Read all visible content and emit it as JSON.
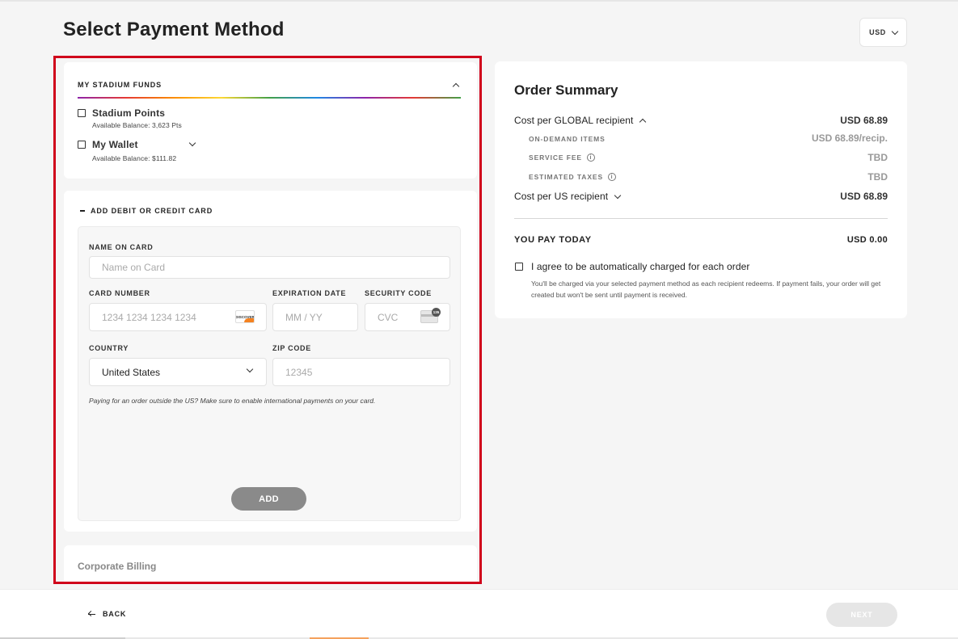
{
  "page": {
    "title": "Select Payment Method"
  },
  "currency": {
    "label": "USD"
  },
  "funds": {
    "header": "MY STADIUM FUNDS",
    "items": [
      {
        "name": "Stadium Points",
        "balance": "Available Balance: 3,623 Pts",
        "checked": false
      },
      {
        "name": "My Wallet",
        "balance": "Available Balance: $111.82",
        "checked": false
      }
    ]
  },
  "card_form": {
    "header": "ADD DEBIT OR CREDIT CARD",
    "name_label": "NAME ON CARD",
    "name_placeholder": "Name on Card",
    "number_label": "CARD NUMBER",
    "number_placeholder": "1234 1234 1234 1234",
    "card_brand": "DISCOVER",
    "expiry_label": "EXPIRATION DATE",
    "expiry_placeholder": "MM / YY",
    "cvc_label": "SECURITY CODE",
    "cvc_placeholder": "CVC",
    "cvc_icon_text": "135",
    "country_label": "COUNTRY",
    "country_value": "United States",
    "zip_label": "ZIP CODE",
    "zip_placeholder": "12345",
    "note": "Paying for an order outside the US? Make sure to enable international payments on your card.",
    "add_label": "ADD"
  },
  "corporate": {
    "label": "Corporate Billing"
  },
  "summary": {
    "title": "Order Summary",
    "global_label": "Cost per GLOBAL recipient",
    "global_value": "USD 68.89",
    "ondemand_label": "ON-DEMAND ITEMS",
    "ondemand_value": "USD 68.89/recip.",
    "service_label": "SERVICE FEE",
    "service_value": "TBD",
    "taxes_label": "ESTIMATED TAXES",
    "taxes_value": "TBD",
    "us_label": "Cost per US recipient",
    "us_value": "USD 68.89",
    "pay_label": "YOU PAY TODAY",
    "pay_value": "USD 0.00",
    "agree_label": "I agree to be automatically charged for each order",
    "agree_note": "You'll be charged via your selected payment method as each recipient redeems. If payment fails, your order will get created but won't be sent until payment is received."
  },
  "footer": {
    "back_label": "BACK",
    "next_label": "NEXT"
  },
  "colors": {
    "highlight_border": "#d0021b",
    "progress_active": "#f5a25d",
    "button_disabled": "#e6e6e6",
    "add_button": "#8a8a8a"
  }
}
